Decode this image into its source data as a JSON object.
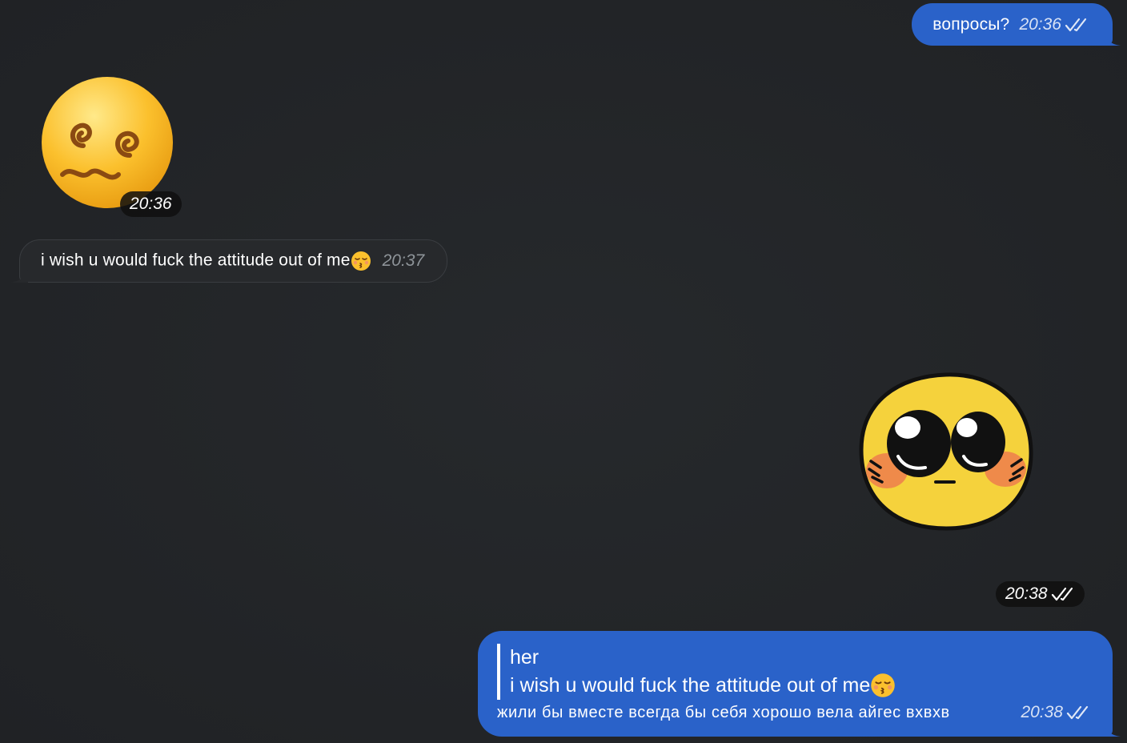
{
  "conversation": {
    "messages": [
      {
        "direction": "outgoing",
        "type": "text",
        "text": "вопросы?",
        "time": "20:36",
        "status_icon": "double-check-icon"
      },
      {
        "direction": "incoming",
        "type": "emoji",
        "emoji_icon": "dizzy-face-spiral-eyes-icon",
        "time": "20:36"
      },
      {
        "direction": "incoming",
        "type": "text",
        "text": "i wish u would fuck the attitude out of me",
        "emoji_icon": "kissing-face-closed-eyes-icon",
        "time": "20:37"
      },
      {
        "direction": "outgoing",
        "type": "sticker",
        "sticker_icon": "blushing-yellow-face-sticker",
        "time": "20:38",
        "status_icon": "double-check-icon"
      },
      {
        "direction": "outgoing",
        "type": "reply",
        "quote_author": "her",
        "quote_text": "i wish u would fuck the attitude out of me",
        "quote_emoji_icon": "kissing-face-closed-eyes-icon",
        "text": "жили бы вместе всегда бы себя хорошо вела айгес вхвхв",
        "time": "20:38",
        "status_icon": "double-check-icon"
      }
    ]
  },
  "colors": {
    "outgoing_bubble": "#2a62c9",
    "incoming_bubble": "#27292c",
    "background": "#232629"
  }
}
